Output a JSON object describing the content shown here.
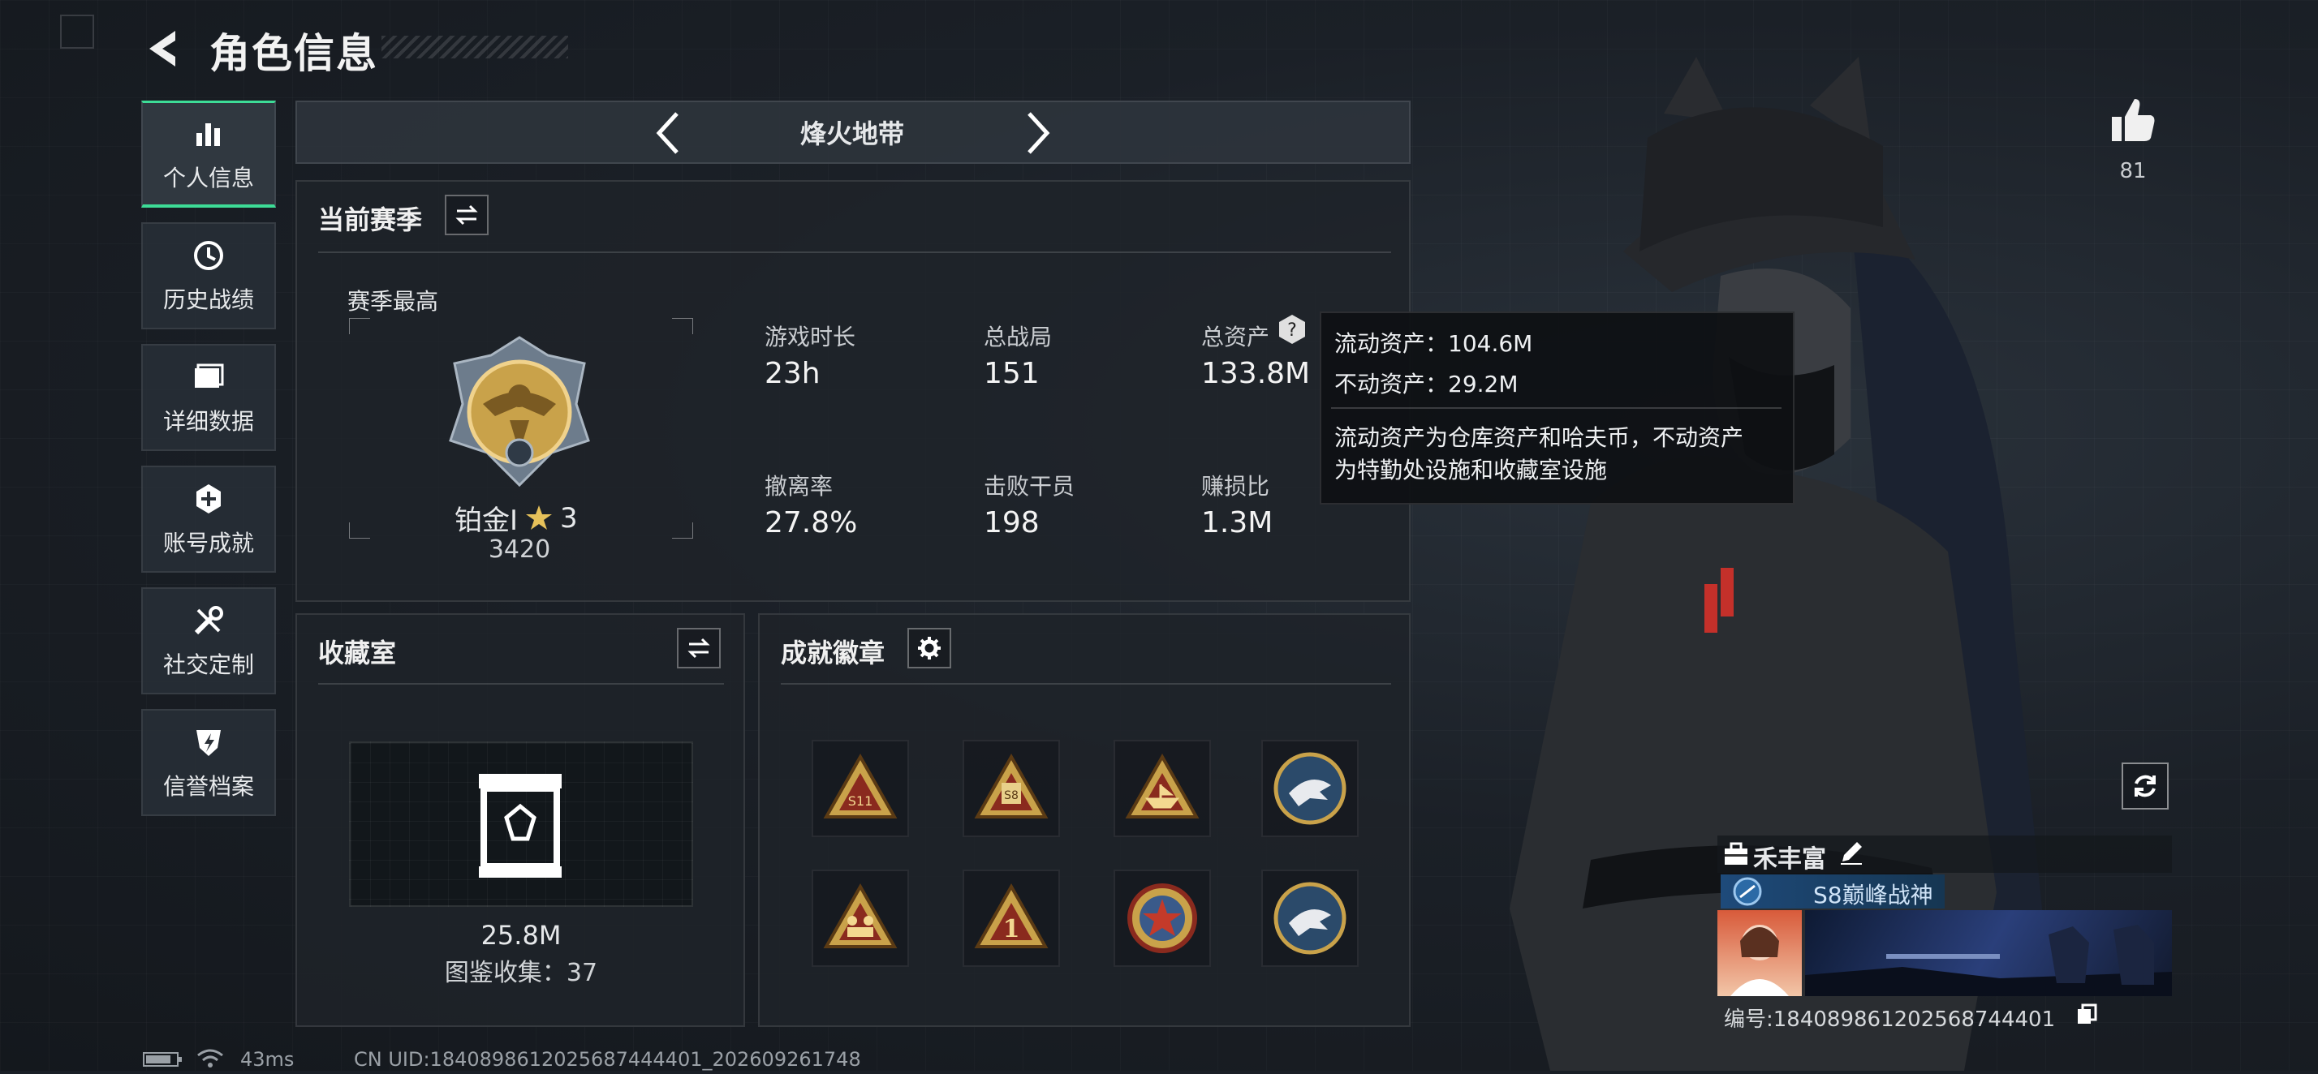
{
  "header": {
    "title": "角色信息"
  },
  "sidebar": {
    "items": [
      {
        "label": "个人信息",
        "icon": "bar-chart-icon",
        "active": true
      },
      {
        "label": "历史战绩",
        "icon": "history-icon"
      },
      {
        "label": "详细数据",
        "icon": "folder-icon"
      },
      {
        "label": "账号成就",
        "icon": "achievement-icon"
      },
      {
        "label": "社交定制",
        "icon": "tools-icon"
      },
      {
        "label": "信誉档案",
        "icon": "credit-shield-icon"
      }
    ]
  },
  "mode_selector": {
    "label": "烽火地带"
  },
  "season": {
    "title": "当前赛季",
    "best_label": "赛季最高",
    "rank_name": "铂金Ⅰ",
    "rank_stars": "3",
    "rank_points": "3420",
    "stats": [
      {
        "label": "游戏时长",
        "value": "23h"
      },
      {
        "label": "总战局",
        "value": "151"
      },
      {
        "label": "总资产",
        "value": "133.8M"
      },
      {
        "label": "撤离率",
        "value": "27.8%"
      },
      {
        "label": "击败干员",
        "value": "198"
      },
      {
        "label": "赚损比",
        "value": "1.3M"
      }
    ]
  },
  "tooltip": {
    "liquid": "流动资产：104.6M",
    "fixed": "不动资产：29.2M",
    "note_line1": "流动资产为仓库资产和哈夫币，不动资产",
    "note_line2": "为特勤处设施和收藏室设施"
  },
  "collection": {
    "title": "收藏室",
    "value": "25.8M",
    "catalog": "图鉴收集：37"
  },
  "badges": {
    "title": "成就徽章",
    "items": [
      {
        "icon": "s11-badge-icon",
        "text": "S11"
      },
      {
        "icon": "s8-badge-icon",
        "text": "S8"
      },
      {
        "icon": "ship-badge-icon",
        "text": ""
      },
      {
        "icon": "eagle-badge-icon",
        "text": ""
      },
      {
        "icon": "squad-badge-icon",
        "text": ""
      },
      {
        "icon": "number-one-badge-icon",
        "text": "1"
      },
      {
        "icon": "star-medal-badge-icon",
        "text": ""
      },
      {
        "icon": "eagle-badge-2-icon",
        "text": ""
      }
    ]
  },
  "likes": {
    "count": "81"
  },
  "player_card": {
    "name": "禾丰富",
    "title": "S8巅峰战神",
    "id_text": "编号:184089861202568744401"
  },
  "status_bar": {
    "ping": "43ms",
    "uid": "CN UID:1840898612025687444401_202609261748"
  },
  "colors": {
    "accent": "#3ddc97",
    "panel": "#1e2329",
    "gold": "#c9a24a"
  }
}
